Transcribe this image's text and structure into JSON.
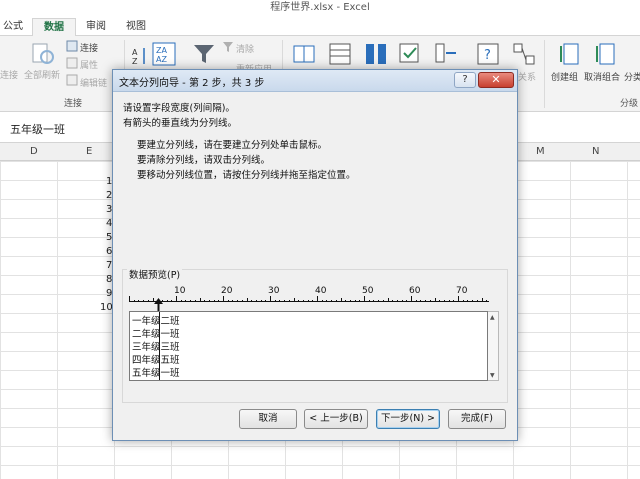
{
  "window": {
    "title": "程序世界.xlsx - Excel"
  },
  "ribbon_tabs": [
    "公式",
    "数据",
    "审阅",
    "视图"
  ],
  "ribbon": {
    "connect_group": {
      "refresh_all": "全部刷新",
      "connections": "连接",
      "properties": "属性",
      "edit_links": "编辑链",
      "group_label": "连接",
      "cut_left": "连接"
    },
    "sort_filter": {
      "sort_az": "ZA\nAZ",
      "clear": "清除",
      "reapply": "重新应用"
    },
    "outline": {
      "group": "创建组",
      "ungroup": "取消组合",
      "subtotal": "分类",
      "group_label": "分级",
      "relations": "关系"
    }
  },
  "formula_bar": {
    "value": "五年级一班"
  },
  "sheet": {
    "columns": [
      "D",
      "E",
      "M",
      "N"
    ],
    "rows": [
      "1",
      "2",
      "3",
      "4",
      "5",
      "6",
      "7",
      "8",
      "9",
      "10"
    ]
  },
  "dialog": {
    "title": "文本分列向导 - 第 2 步，共 3 步",
    "help": "?",
    "close": "✕",
    "instructions": [
      "请设置字段宽度(列间隔)。",
      "有箭头的垂直线为分列线。"
    ],
    "tips": [
      "要建立分列线，请在要建立分列处单击鼠标。",
      "要清除分列线，请双击分列线。",
      "要移动分列线位置，请按住分列线并拖至指定位置。"
    ],
    "preview_label": "数据预览(P)",
    "ruler": [
      "10",
      "20",
      "30",
      "40",
      "50",
      "60",
      "70"
    ],
    "preview_lines": [
      "一年级二班",
      "二年级一班",
      "三年级三班",
      "四年级五班",
      "五年级一班"
    ],
    "buttons": {
      "cancel": "取消",
      "back": "< 上一步(B)",
      "next": "下一步(N) >",
      "finish": "完成(F)"
    }
  }
}
